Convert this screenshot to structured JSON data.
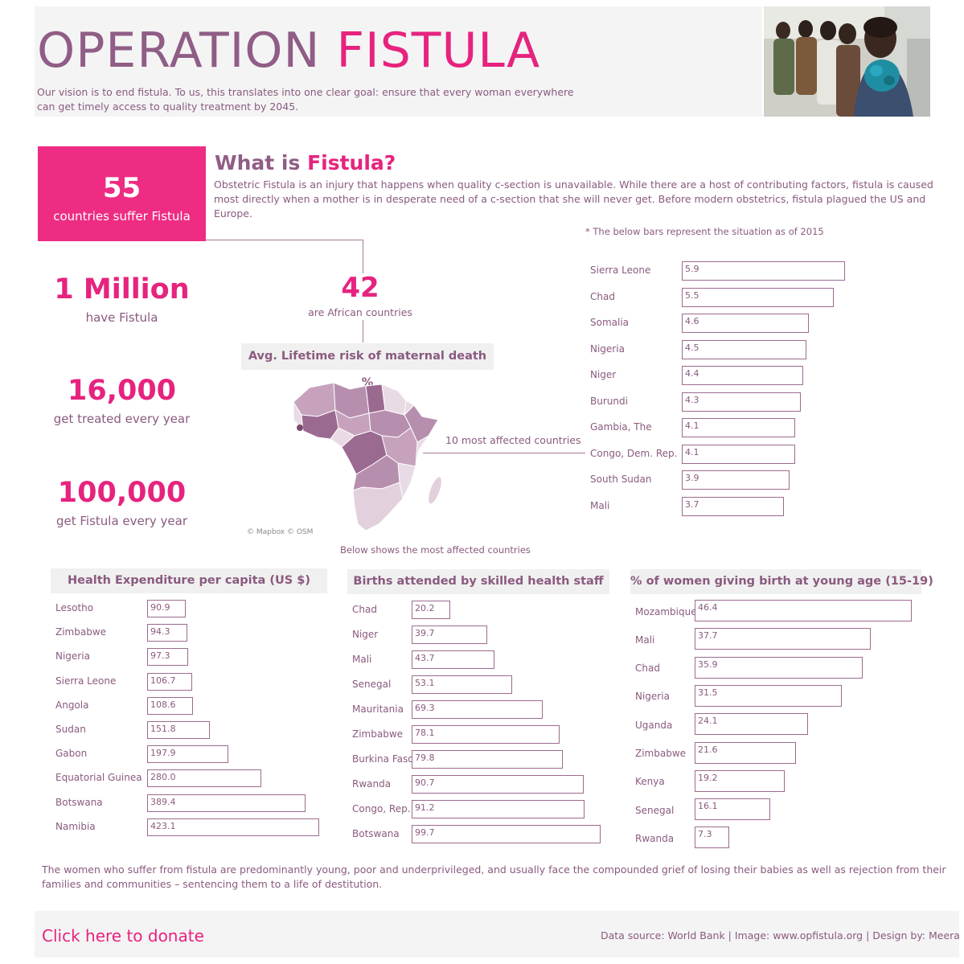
{
  "header": {
    "title_part1": "OPERATION",
    "title_part2": "FISTULA",
    "vision_line1": "Our vision is to end fistula. To us, this translates into one clear goal: ensure that every woman everywhere",
    "vision_line2": "can get timely access to quality treatment by 2045."
  },
  "kpis": {
    "countries": {
      "value": "55",
      "label": "countries suffer Fistula"
    },
    "million": {
      "value": "1 Million",
      "label": "have Fistula"
    },
    "treated": {
      "value": "16,000",
      "label": "get treated every year"
    },
    "new_cases": {
      "value": "100,000",
      "label": "get Fistula every year"
    },
    "african": {
      "value": "42",
      "label": "are African countries"
    }
  },
  "what": {
    "title_part1": "What is",
    "title_part2": "Fistula?",
    "line1": "Obstetric Fistula is an injury that happens when quality c-section is unavailable. While there are a host of contributing factors, fistula is caused",
    "line2": "most directly when a mother is in desperate need of a c-section that she will never get. Before modern obstetrics, fistula plagued the US and",
    "line3": "Europe."
  },
  "notes": {
    "bars_note": "* The below bars represent the situation as of 2015",
    "affected_label": "10 most affected countries",
    "below_label": "Below shows the most affected countries",
    "mapbox": "© Mapbox © OSM"
  },
  "map": {
    "title": "Avg. Lifetime risk of maternal death %",
    "colors": {
      "light": "#e9dbe5",
      "mid": "#c7a2bd",
      "dark": "#9b6a90",
      "ocean": "#ffffff"
    }
  },
  "chart_data": [
    {
      "type": "bar",
      "id": "lifetime-risk",
      "title": "",
      "categories": [
        "Sierra Leone",
        "Chad",
        "Somalia",
        "Nigeria",
        "Niger",
        "Burundi",
        "Gambia, The",
        "Congo, Dem. Rep.",
        "South Sudan",
        "Mali"
      ],
      "values": [
        5.9,
        5.5,
        4.6,
        4.5,
        4.4,
        4.3,
        4.1,
        4.1,
        3.9,
        3.7
      ],
      "value_labels": [
        "5.9",
        "5.5",
        "4.6",
        "4.5",
        "4.4",
        "4.3",
        "4.1",
        "4.1",
        "3.9",
        "3.7"
      ],
      "orientation": "horizontal"
    },
    {
      "type": "bar",
      "id": "health-expenditure",
      "title": "Health Expenditure per capita (US $)",
      "categories": [
        "Lesotho",
        "Zimbabwe",
        "Nigeria",
        "Sierra Leone",
        "Angola",
        "Sudan",
        "Gabon",
        "Equatorial Guinea",
        "Botswana",
        "Namibia"
      ],
      "values": [
        90.9,
        94.3,
        97.3,
        106.7,
        108.6,
        151.8,
        197.9,
        280.0,
        389.4,
        423.1
      ],
      "value_labels": [
        "90.9",
        "94.3",
        "97.3",
        "106.7",
        "108.6",
        "151.8",
        "197.9",
        "280.0",
        "389.4",
        "423.1"
      ],
      "orientation": "horizontal"
    },
    {
      "type": "bar",
      "id": "births-attended",
      "title": "Births attended by skilled health staff",
      "categories": [
        "Chad",
        "Niger",
        "Mali",
        "Senegal",
        "Mauritania",
        "Zimbabwe",
        "Burkina Faso",
        "Rwanda",
        "Congo, Rep.",
        "Botswana"
      ],
      "values": [
        20.2,
        39.7,
        43.7,
        53.1,
        69.3,
        78.1,
        79.8,
        90.7,
        91.2,
        99.7
      ],
      "value_labels": [
        "20.2",
        "39.7",
        "43.7",
        "53.1",
        "69.3",
        "78.1",
        "79.8",
        "90.7",
        "91.2",
        "99.7"
      ],
      "orientation": "horizontal"
    },
    {
      "type": "bar",
      "id": "young-births",
      "title": "% of women giving birth at young age (15-19)",
      "categories": [
        "Mozambique",
        "Mali",
        "Chad",
        "Nigeria",
        "Uganda",
        "Zimbabwe",
        "Kenya",
        "Senegal",
        "Rwanda"
      ],
      "values": [
        46.4,
        37.7,
        35.9,
        31.5,
        24.1,
        21.6,
        19.2,
        16.1,
        7.3
      ],
      "value_labels": [
        "46.4",
        "37.7",
        "35.9",
        "31.5",
        "24.1",
        "21.6",
        "19.2",
        "16.1",
        "7.3"
      ],
      "orientation": "horizontal"
    }
  ],
  "footer": {
    "note_line1": "The women who suffer from fistula are predominantly young, poor and underprivileged, and usually face the compounded grief of losing their babies as well as rejection from their",
    "note_line2": "families and communities – sentencing them to a life of destitution.",
    "donate": "Click here to donate",
    "credits": "Data source: World Bank | Image: www.opfistula.org | Design by: Meera"
  },
  "colors": {
    "pink": "#e6237e",
    "plum": "#8f5d86",
    "text": "#8a5a7f",
    "bar_border": "#9c6b8f"
  }
}
